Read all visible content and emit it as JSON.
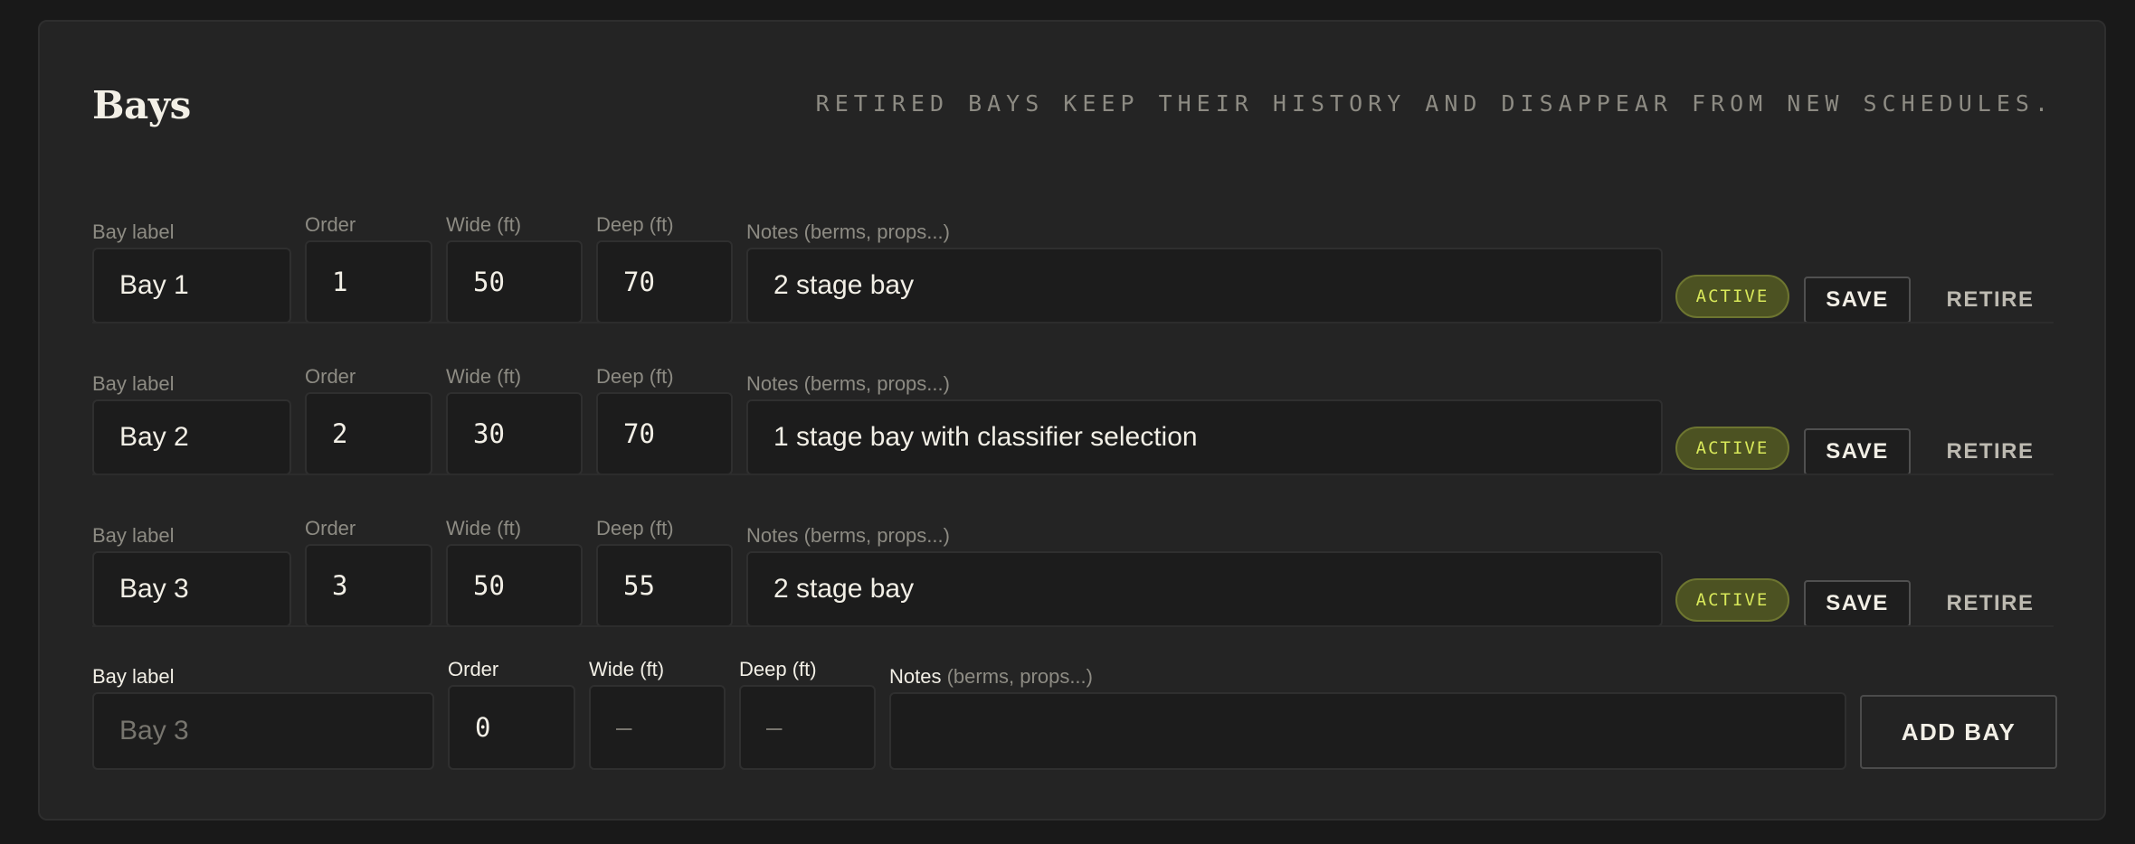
{
  "header": {
    "title": "Bays",
    "hint": "RETIRED BAYS KEEP THEIR HISTORY AND DISAPPEAR FROM NEW SCHEDULES."
  },
  "labels": {
    "bay_label": "Bay label",
    "order": "Order",
    "wide": "Wide (ft)",
    "deep": "Deep (ft)",
    "notes": "Notes (berms, props...)",
    "notes_main": "Notes",
    "notes_sub": "(berms, props...)"
  },
  "bays": [
    {
      "label": "Bay 1",
      "order": "1",
      "wide": "50",
      "deep": "70",
      "notes": "2 stage bay",
      "status": "ACTIVE",
      "save": "SAVE",
      "retire": "RETIRE"
    },
    {
      "label": "Bay 2",
      "order": "2",
      "wide": "30",
      "deep": "70",
      "notes": "1 stage bay with classifier selection",
      "status": "ACTIVE",
      "save": "SAVE",
      "retire": "RETIRE"
    },
    {
      "label": "Bay 3",
      "order": "3",
      "wide": "50",
      "deep": "55",
      "notes": "2 stage bay",
      "status": "ACTIVE",
      "save": "SAVE",
      "retire": "RETIRE"
    }
  ],
  "new_bay": {
    "label_placeholder": "Bay 3",
    "order": "0",
    "wide_placeholder": "—",
    "deep_placeholder": "—",
    "notes": "",
    "add_label": "ADD BAY"
  },
  "colors": {
    "background": "#191919",
    "panel": "#242424",
    "active_badge_text": "#d8e85a",
    "active_badge_bg": "#4c5222"
  }
}
